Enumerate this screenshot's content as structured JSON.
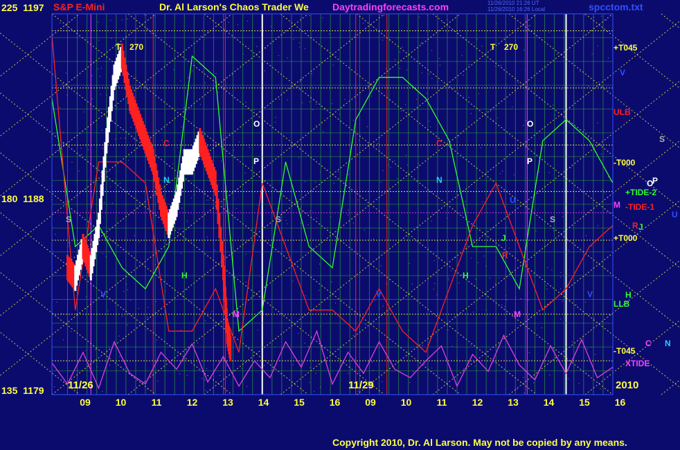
{
  "header": {
    "instrument": "S&P E-Mini",
    "title": "Dr. Al Larson's Chaos Trader We",
    "site": "Daytradingforecasts.com",
    "stamp_line1": "11/26/2010 21:26 UT",
    "stamp_line2": "11/26/2010 16:26 Local",
    "file": "spcctom.txt"
  },
  "y_axis": {
    "top": {
      "angle": "225",
      "price": "1197"
    },
    "mid": {
      "angle": "180",
      "price": "1188"
    },
    "bottom": {
      "angle": "135",
      "price": "1179"
    }
  },
  "x_axis": {
    "hours": [
      "09",
      "10",
      "11",
      "12",
      "13",
      "14",
      "15",
      "16",
      "09",
      "10",
      "11",
      "12",
      "13",
      "14",
      "15",
      "16"
    ],
    "date1": "11/26",
    "date2": "11/29",
    "year": "2010"
  },
  "right_labels": [
    {
      "text": "+T045",
      "color": "#ffff40"
    },
    {
      "text": "V",
      "color": "#3050ff"
    },
    {
      "text": "ULB",
      "color": "#ff2020"
    },
    {
      "text": "S",
      "color": "#b0b0b0"
    },
    {
      "text": "-T000",
      "color": "#ffff40"
    },
    {
      "text": "O",
      "color": "#ffffff"
    },
    {
      "text": "P",
      "color": "#ffffff"
    },
    {
      "text": "+TIDE-2",
      "color": "#30ff30"
    },
    {
      "text": "M",
      "color": "#ff40ff"
    },
    {
      "text": "-TIDE-1",
      "color": "#ff2020"
    },
    {
      "text": "U",
      "color": "#3050ff"
    },
    {
      "text": "R",
      "color": "#ff2020"
    },
    {
      "text": "J",
      "color": "#30ff30"
    },
    {
      "text": "+T000",
      "color": "#ffff40"
    },
    {
      "text": "H",
      "color": "#30ff30"
    },
    {
      "text": "LLB",
      "color": "#30ff30"
    },
    {
      "text": "C",
      "color": "#ff40ff"
    },
    {
      "text": "N",
      "color": "#20d0ff"
    },
    {
      "text": "-T045",
      "color": "#ffff40"
    },
    {
      "text": "XTIDE",
      "color": "#ff40ff"
    }
  ],
  "chart_labels": [
    {
      "text": "T",
      "color": "#ffff40"
    },
    {
      "text": "270",
      "color": "#ffff40"
    },
    {
      "text": "T",
      "color": "#ffff40"
    },
    {
      "text": "270",
      "color": "#ffff40"
    },
    {
      "text": "C",
      "color": "#ff2020"
    },
    {
      "text": "C",
      "color": "#ff2020"
    },
    {
      "text": "O",
      "color": "#ffffff"
    },
    {
      "text": "O",
      "color": "#ffffff"
    },
    {
      "text": "P",
      "color": "#ffffff"
    },
    {
      "text": "P",
      "color": "#ffffff"
    },
    {
      "text": "N",
      "color": "#20d0ff"
    },
    {
      "text": "N",
      "color": "#20d0ff"
    },
    {
      "text": "S",
      "color": "#b0b0b0"
    },
    {
      "text": "S",
      "color": "#b0b0b0"
    },
    {
      "text": "S",
      "color": "#b0b0b0"
    },
    {
      "text": "H",
      "color": "#30ff30"
    },
    {
      "text": "H",
      "color": "#30ff30"
    },
    {
      "text": "V",
      "color": "#3050ff"
    },
    {
      "text": "V",
      "color": "#3050ff"
    },
    {
      "text": "V",
      "color": "#3050ff"
    },
    {
      "text": "M",
      "color": "#ff40ff"
    },
    {
      "text": "M",
      "color": "#ff40ff"
    },
    {
      "text": "J",
      "color": "#30ff30"
    },
    {
      "text": "R",
      "color": "#ff2020"
    },
    {
      "text": "U",
      "color": "#3050ff"
    }
  ],
  "copyright": "Copyright 2010, Dr. Al Larson. May not be copied by any means.",
  "colors": {
    "background": "#0b0b6e",
    "price_up": "#ffffff",
    "price_down": "#ff2020",
    "grid_yellow": "#ffff40",
    "grid_green": "#30c030",
    "tide_green": "#30ff30",
    "tide_red": "#ff2020",
    "xtide": "#e040e0"
  },
  "chart_data": {
    "type": "line",
    "title": "S&P E-Mini",
    "ylim": [
      1179,
      1197
    ],
    "y_ticks": [
      1179,
      1188,
      1197
    ],
    "x_ticks": [
      "09",
      "10",
      "11",
      "12",
      "13",
      "14",
      "15",
      "16",
      "09",
      "10",
      "11",
      "12",
      "13",
      "14",
      "15",
      "16"
    ],
    "series": [
      {
        "name": "S&P E-Mini",
        "x": [
          9.0,
          9.2,
          9.4,
          9.6,
          9.8,
          10.0,
          10.2,
          10.4,
          10.6,
          10.8,
          11.0,
          11.2,
          11.4,
          11.6,
          11.8,
          12.0,
          12.2,
          12.4,
          12.6,
          12.8,
          13.0,
          13.1,
          13.2
        ],
        "values": [
          1185,
          1184.5,
          1186,
          1185,
          1187,
          1191,
          1194,
          1195,
          1193,
          1192,
          1191,
          1190,
          1188,
          1187,
          1188,
          1190,
          1190,
          1191,
          1190,
          1189,
          1185,
          1182,
          1181
        ]
      },
      {
        "name": "+TIDE-2",
        "x": [
          8.6,
          9.2,
          9.8,
          10.4,
          11.0,
          11.6,
          12.2,
          12.8,
          13.4,
          14.0,
          14.6,
          15.2,
          15.8,
          16.4,
          17.0,
          17.6,
          18.2,
          18.8,
          19.4,
          20.0,
          20.6,
          21.2,
          21.8,
          22.4,
          23.0
        ],
        "values": [
          1193,
          1186,
          1187,
          1185,
          1184,
          1186,
          1195,
          1194,
          1182,
          1183,
          1190,
          1186,
          1185,
          1192,
          1194,
          1194,
          1193,
          1191,
          1186,
          1186,
          1184,
          1191,
          1192,
          1191,
          1189
        ]
      },
      {
        "name": "-TIDE-1",
        "x": [
          8.6,
          9.2,
          9.8,
          10.4,
          11.0,
          11.6,
          12.2,
          12.8,
          13.4,
          14.0,
          14.6,
          15.2,
          15.8,
          16.4,
          17.0,
          17.6,
          18.2,
          18.8,
          19.4,
          20.0,
          20.6,
          21.2,
          21.8,
          22.4,
          23.0
        ],
        "values": [
          1196,
          1183,
          1190,
          1190,
          1189,
          1182,
          1182,
          1184,
          1181,
          1189,
          1186,
          1183,
          1183,
          1182,
          1184,
          1182,
          1181,
          1184,
          1187,
          1189,
          1186,
          1183,
          1184,
          1186,
          1187
        ]
      },
      {
        "name": "XTIDE",
        "x": [
          8.6,
          9.0,
          9.4,
          9.8,
          10.2,
          10.6,
          11.0,
          11.4,
          11.8,
          12.2,
          12.6,
          13.0,
          13.4,
          13.8,
          14.2,
          14.6,
          15.0,
          15.4,
          15.8,
          16.2,
          16.6,
          17.0,
          17.4,
          17.8,
          18.2,
          18.6,
          19.0,
          19.4,
          19.8,
          20.2,
          20.6,
          21.0,
          21.4,
          21.8,
          22.2,
          22.6,
          23.0
        ],
        "values": [
          1180.5,
          1179.5,
          1181,
          1179.3,
          1181.5,
          1180,
          1179.5,
          1181,
          1180.2,
          1181.4,
          1179.6,
          1180.8,
          1179.4,
          1180.6,
          1179.8,
          1181.5,
          1180.3,
          1182,
          1179.5,
          1181,
          1180,
          1181.5,
          1180.2,
          1179.8,
          1180.6,
          1181.3,
          1179.4,
          1180.9,
          1180.1,
          1181.8,
          1180.4,
          1179.7,
          1181.3,
          1180,
          1181.6,
          1179.8,
          1180.3
        ]
      }
    ],
    "levels": [
      {
        "name": "+T045",
        "value": 1196.2
      },
      {
        "name": "ULB",
        "value": 1193.5
      },
      {
        "name": "-T000",
        "value": 1190.8
      },
      {
        "name": "+TIDE-2",
        "value": 1188.6
      },
      {
        "name": "-TIDE-1",
        "value": 1187.6
      },
      {
        "name": "+T000",
        "value": 1186.3
      },
      {
        "name": "LLB",
        "value": 1182.8
      },
      {
        "name": "-T045",
        "value": 1180.6
      }
    ]
  }
}
